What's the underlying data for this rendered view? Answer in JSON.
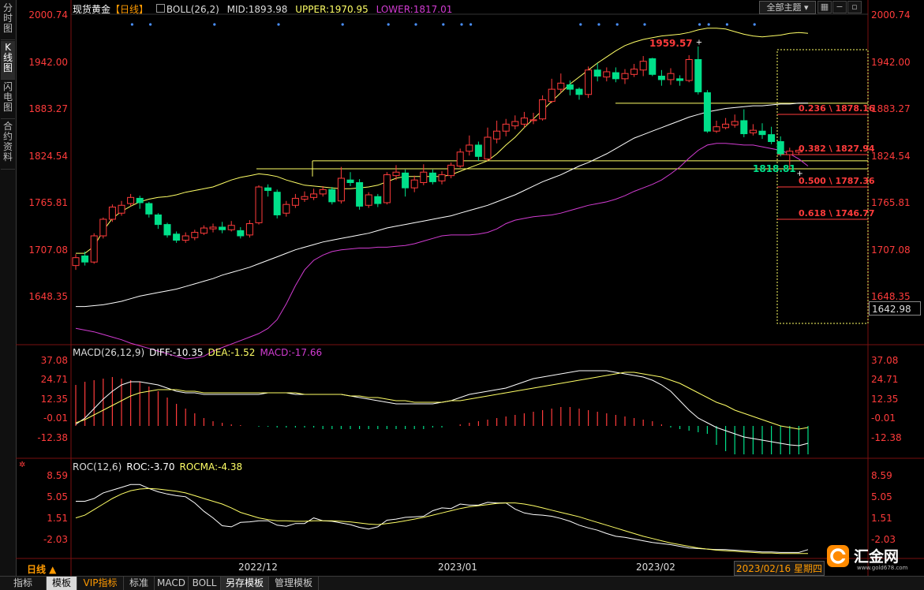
{
  "left_tabs": [
    "分时图",
    "K线图",
    "闪电图",
    "合约资料"
  ],
  "main_legend": {
    "symbol": "现货黄金",
    "period_tag": "【日线】",
    "indicator": "BOLL(26,2)",
    "mid": "MID:1893.98",
    "upper": "UPPER:1970.95",
    "lower": "LOWER:1817.01"
  },
  "theme_select": "全部主题",
  "price_axis": [
    "2000.74",
    "1942.00",
    "1883.27",
    "1824.54",
    "1765.81",
    "1707.08",
    "1648.35"
  ],
  "current_price_box": "1642.98",
  "annotations": {
    "high": "1959.57",
    "low": "1818.81"
  },
  "fib_labels": [
    "0.236 \\ 1878.16",
    "0.382 \\ 1827.94",
    "0.500 \\ 1787.36",
    "0.618 \\ 1746.77"
  ],
  "macd": {
    "legend": {
      "name": "MACD(26,12,9)",
      "diff": "DIFF:-10.35",
      "dea": "DEA:-1.52",
      "macd": "MACD:-17.66"
    },
    "axis": [
      "37.08",
      "24.71",
      "12.35",
      "-0.01",
      "-12.38"
    ]
  },
  "roc": {
    "legend": {
      "name": "ROC(12,6)",
      "roc": "ROC:-3.70",
      "rocma": "ROCMA:-4.38"
    },
    "axis": [
      "8.59",
      "5.05",
      "1.51",
      "-2.03"
    ]
  },
  "time_axis": [
    "2022/12",
    "2023/01",
    "2023/02"
  ],
  "period_label": "日线 ▲",
  "cursor_date": "2023/02/16 星期四",
  "bottom_tabs": [
    "指标",
    "模板",
    "VIP指标",
    "标准",
    "MACD",
    "BOLL",
    "另存模板",
    "管理模板"
  ],
  "active_bottom_tab": "模板",
  "logo": {
    "text": "汇金网",
    "url": "www.gold678.com"
  },
  "colors": {
    "up": "#ff3b3b",
    "down": "#00e08a",
    "boll_upper": "#ffff66",
    "boll_mid": "#ffffff",
    "boll_lower": "#d23cd2",
    "fib": "#ff3b3b",
    "accent": "#ff9a00"
  },
  "chart_data": {
    "type": "candlestick",
    "ylim": [
      1620,
      2005
    ],
    "candles": [
      {
        "o": 1708,
        "c": 1717,
        "h": 1721,
        "l": 1703
      },
      {
        "o": 1719,
        "c": 1712,
        "h": 1724,
        "l": 1708
      },
      {
        "o": 1712,
        "c": 1742,
        "h": 1745,
        "l": 1710
      },
      {
        "o": 1742,
        "c": 1761,
        "h": 1763,
        "l": 1739
      },
      {
        "o": 1761,
        "c": 1775,
        "h": 1778,
        "l": 1758
      },
      {
        "o": 1768,
        "c": 1777,
        "h": 1782,
        "l": 1765
      },
      {
        "o": 1779,
        "c": 1786,
        "h": 1790,
        "l": 1776
      },
      {
        "o": 1785,
        "c": 1780,
        "h": 1788,
        "l": 1773
      },
      {
        "o": 1779,
        "c": 1767,
        "h": 1781,
        "l": 1763
      },
      {
        "o": 1766,
        "c": 1755,
        "h": 1768,
        "l": 1750
      },
      {
        "o": 1755,
        "c": 1743,
        "h": 1757,
        "l": 1740
      },
      {
        "o": 1744,
        "c": 1737,
        "h": 1747,
        "l": 1734
      },
      {
        "o": 1737,
        "c": 1742,
        "h": 1746,
        "l": 1734
      },
      {
        "o": 1740,
        "c": 1746,
        "h": 1749,
        "l": 1737
      },
      {
        "o": 1745,
        "c": 1751,
        "h": 1754,
        "l": 1743
      },
      {
        "o": 1750,
        "c": 1752,
        "h": 1756,
        "l": 1746
      },
      {
        "o": 1752,
        "c": 1749,
        "h": 1758,
        "l": 1745
      },
      {
        "o": 1749,
        "c": 1754,
        "h": 1759,
        "l": 1747
      },
      {
        "o": 1748,
        "c": 1742,
        "h": 1752,
        "l": 1739
      },
      {
        "o": 1743,
        "c": 1756,
        "h": 1760,
        "l": 1740
      },
      {
        "o": 1757,
        "c": 1798,
        "h": 1800,
        "l": 1755
      },
      {
        "o": 1797,
        "c": 1794,
        "h": 1801,
        "l": 1787
      },
      {
        "o": 1792,
        "c": 1766,
        "h": 1795,
        "l": 1762
      },
      {
        "o": 1768,
        "c": 1778,
        "h": 1782,
        "l": 1764
      },
      {
        "o": 1777,
        "c": 1785,
        "h": 1790,
        "l": 1774
      },
      {
        "o": 1784,
        "c": 1787,
        "h": 1793,
        "l": 1781
      },
      {
        "o": 1786,
        "c": 1790,
        "h": 1796,
        "l": 1783
      },
      {
        "o": 1790,
        "c": 1795,
        "h": 1799,
        "l": 1787
      },
      {
        "o": 1795,
        "c": 1781,
        "h": 1798,
        "l": 1778
      },
      {
        "o": 1782,
        "c": 1808,
        "h": 1821,
        "l": 1779
      },
      {
        "o": 1806,
        "c": 1803,
        "h": 1815,
        "l": 1799
      },
      {
        "o": 1803,
        "c": 1776,
        "h": 1807,
        "l": 1772
      },
      {
        "o": 1777,
        "c": 1789,
        "h": 1792,
        "l": 1774
      },
      {
        "o": 1787,
        "c": 1779,
        "h": 1790,
        "l": 1775
      },
      {
        "o": 1780,
        "c": 1812,
        "h": 1815,
        "l": 1778
      },
      {
        "o": 1811,
        "c": 1815,
        "h": 1823,
        "l": 1806
      },
      {
        "o": 1814,
        "c": 1797,
        "h": 1818,
        "l": 1787
      },
      {
        "o": 1797,
        "c": 1806,
        "h": 1811,
        "l": 1792
      },
      {
        "o": 1803,
        "c": 1815,
        "h": 1824,
        "l": 1800
      },
      {
        "o": 1814,
        "c": 1804,
        "h": 1818,
        "l": 1801
      },
      {
        "o": 1805,
        "c": 1812,
        "h": 1816,
        "l": 1801
      },
      {
        "o": 1811,
        "c": 1823,
        "h": 1826,
        "l": 1808
      },
      {
        "o": 1822,
        "c": 1838,
        "h": 1842,
        "l": 1820
      },
      {
        "o": 1839,
        "c": 1846,
        "h": 1857,
        "l": 1834
      },
      {
        "o": 1846,
        "c": 1833,
        "h": 1850,
        "l": 1828
      },
      {
        "o": 1830,
        "c": 1855,
        "h": 1866,
        "l": 1828
      },
      {
        "o": 1853,
        "c": 1862,
        "h": 1874,
        "l": 1848
      },
      {
        "o": 1862,
        "c": 1870,
        "h": 1876,
        "l": 1856
      },
      {
        "o": 1868,
        "c": 1873,
        "h": 1880,
        "l": 1864
      },
      {
        "o": 1870,
        "c": 1877,
        "h": 1884,
        "l": 1866
      },
      {
        "o": 1874,
        "c": 1875,
        "h": 1883,
        "l": 1870
      },
      {
        "o": 1876,
        "c": 1898,
        "h": 1903,
        "l": 1874
      },
      {
        "o": 1896,
        "c": 1910,
        "h": 1922,
        "l": 1894
      },
      {
        "o": 1910,
        "c": 1917,
        "h": 1928,
        "l": 1906
      },
      {
        "o": 1915,
        "c": 1910,
        "h": 1920,
        "l": 1903
      },
      {
        "o": 1910,
        "c": 1904,
        "h": 1912,
        "l": 1898
      },
      {
        "o": 1904,
        "c": 1932,
        "h": 1936,
        "l": 1900
      },
      {
        "o": 1932,
        "c": 1925,
        "h": 1940,
        "l": 1919
      },
      {
        "o": 1924,
        "c": 1930,
        "h": 1935,
        "l": 1919
      },
      {
        "o": 1929,
        "c": 1922,
        "h": 1935,
        "l": 1918
      },
      {
        "o": 1922,
        "c": 1928,
        "h": 1933,
        "l": 1916
      },
      {
        "o": 1927,
        "c": 1933,
        "h": 1939,
        "l": 1924
      },
      {
        "o": 1932,
        "c": 1942,
        "h": 1948,
        "l": 1925
      },
      {
        "o": 1945,
        "c": 1927,
        "h": 1946,
        "l": 1925
      },
      {
        "o": 1925,
        "c": 1921,
        "h": 1932,
        "l": 1914
      },
      {
        "o": 1921,
        "c": 1928,
        "h": 1934,
        "l": 1915
      },
      {
        "o": 1922,
        "c": 1920,
        "h": 1926,
        "l": 1914
      },
      {
        "o": 1920,
        "c": 1944,
        "h": 1949,
        "l": 1918
      },
      {
        "o": 1944,
        "c": 1907,
        "h": 1959,
        "l": 1904
      },
      {
        "o": 1906,
        "c": 1862,
        "h": 1909,
        "l": 1860
      },
      {
        "o": 1862,
        "c": 1867,
        "h": 1874,
        "l": 1860
      },
      {
        "o": 1866,
        "c": 1870,
        "h": 1877,
        "l": 1864
      },
      {
        "o": 1869,
        "c": 1873,
        "h": 1881,
        "l": 1866
      },
      {
        "o": 1874,
        "c": 1859,
        "h": 1887,
        "l": 1855
      },
      {
        "o": 1860,
        "c": 1863,
        "h": 1870,
        "l": 1857
      },
      {
        "o": 1862,
        "c": 1858,
        "h": 1871,
        "l": 1853
      },
      {
        "o": 1858,
        "c": 1850,
        "h": 1867,
        "l": 1847
      },
      {
        "o": 1850,
        "c": 1836,
        "h": 1856,
        "l": 1833
      },
      {
        "o": 1835,
        "c": 1839,
        "h": 1843,
        "l": 1819
      },
      {
        "o": 1838,
        "c": 1840,
        "h": 1841,
        "l": 1835
      }
    ],
    "boll_upper": [
      1722,
      1722,
      1730,
      1748,
      1762,
      1770,
      1776,
      1781,
      1784,
      1786,
      1787,
      1789,
      1792,
      1794,
      1796,
      1798,
      1802,
      1806,
      1809,
      1811,
      1813,
      1812,
      1810,
      1806,
      1803,
      1800,
      1799,
      1798,
      1797,
      1796,
      1796,
      1797,
      1798,
      1800,
      1804,
      1808,
      1810,
      1810,
      1810,
      1810,
      1810,
      1812,
      1816,
      1820,
      1824,
      1828,
      1836,
      1846,
      1855,
      1866,
      1876,
      1886,
      1896,
      1906,
      1916,
      1924,
      1932,
      1940,
      1947,
      1954,
      1960,
      1964,
      1967,
      1969,
      1971,
      1972,
      1973,
      1975,
      1978,
      1980,
      1980,
      1979,
      1976,
      1973,
      1971,
      1970,
      1971,
      1972,
      1974,
      1975,
      1974
    ],
    "boll_mid": [
      1661,
      1661,
      1662,
      1663,
      1665,
      1667,
      1670,
      1673,
      1675,
      1677,
      1679,
      1681,
      1684,
      1687,
      1690,
      1693,
      1697,
      1700,
      1703,
      1706,
      1710,
      1714,
      1718,
      1722,
      1726,
      1729,
      1732,
      1735,
      1737,
      1739,
      1741,
      1743,
      1745,
      1748,
      1751,
      1753,
      1755,
      1757,
      1759,
      1761,
      1763,
      1765,
      1768,
      1771,
      1774,
      1777,
      1781,
      1785,
      1789,
      1794,
      1799,
      1804,
      1808,
      1812,
      1817,
      1822,
      1826,
      1831,
      1836,
      1842,
      1848,
      1854,
      1858,
      1862,
      1866,
      1870,
      1874,
      1878,
      1881,
      1884,
      1886,
      1888,
      1889,
      1890,
      1891,
      1891,
      1892,
      1893,
      1893,
      1894,
      1894
    ],
    "boll_lower": [
      1636,
      1634,
      1632,
      1629,
      1626,
      1623,
      1619,
      1616,
      1613,
      1610,
      1607,
      1604,
      1601,
      1602,
      1604,
      1610,
      1614,
      1618,
      1622,
      1626,
      1630,
      1636,
      1646,
      1664,
      1685,
      1703,
      1714,
      1720,
      1724,
      1726,
      1727,
      1728,
      1728,
      1729,
      1729,
      1730,
      1731,
      1733,
      1736,
      1739,
      1742,
      1743,
      1743,
      1743,
      1744,
      1746,
      1750,
      1756,
      1760,
      1762,
      1764,
      1765,
      1766,
      1768,
      1771,
      1774,
      1777,
      1779,
      1781,
      1784,
      1788,
      1793,
      1797,
      1801,
      1806,
      1813,
      1821,
      1831,
      1840,
      1846,
      1848,
      1848,
      1847,
      1846,
      1846,
      1844,
      1842,
      1840,
      1836,
      1830,
      1822
    ],
    "macd_hist": [
      26,
      28,
      29,
      30,
      31,
      30,
      29,
      28,
      25,
      22,
      18,
      14,
      11,
      8,
      5,
      3,
      2,
      1,
      0.5,
      0,
      -0.5,
      -0.5,
      -1,
      -1,
      -1,
      -1,
      -1,
      -2,
      -2,
      -2,
      -2,
      -2,
      -2,
      -2,
      -2,
      -2,
      -2,
      -2,
      -2,
      -1,
      -1,
      0,
      1,
      2,
      3,
      4,
      5,
      6,
      7,
      8,
      9,
      10,
      11,
      12,
      12,
      11,
      10,
      9,
      8,
      7,
      6,
      5,
      4,
      3,
      1,
      -1,
      -2,
      -3,
      -4,
      -5,
      -12,
      -16,
      -18,
      -18,
      -18,
      -18,
      -18,
      -18,
      -18,
      -18,
      -18
    ],
    "macd_diff": [
      1,
      5,
      11,
      17,
      22,
      26,
      28,
      28,
      27,
      26,
      24,
      22,
      21,
      21,
      20,
      20,
      20,
      20,
      20,
      20,
      20,
      21,
      21,
      21,
      20,
      20,
      20,
      20,
      20,
      20,
      19,
      18,
      17,
      16,
      15,
      14,
      14,
      14,
      14,
      14,
      15,
      16,
      18,
      20,
      21,
      22,
      23,
      24,
      26,
      28,
      30,
      31,
      32,
      33,
      34,
      35,
      35,
      35,
      35,
      34,
      33,
      32,
      31,
      29,
      26,
      22,
      16,
      10,
      5,
      2,
      -1,
      -3,
      -5,
      -7,
      -8,
      -9,
      -10,
      -11,
      -12,
      -12.5,
      -11
    ],
    "macd_dea": [
      2,
      4,
      7,
      10,
      13,
      16,
      19,
      21,
      22,
      23,
      23,
      23,
      22,
      22,
      21,
      21,
      21,
      21,
      21,
      21,
      21,
      21,
      21,
      21,
      21,
      20,
      20,
      20,
      20,
      20,
      19,
      19,
      18,
      18,
      17,
      16,
      16,
      15,
      15,
      15,
      15,
      16,
      16,
      17,
      18,
      19,
      20,
      21,
      22,
      23,
      24,
      25,
      26,
      27,
      28,
      29,
      30,
      31,
      32,
      33,
      34,
      34,
      33,
      32,
      31,
      29,
      27,
      24,
      21,
      18,
      15,
      13,
      10,
      8,
      6,
      4,
      2,
      0,
      -1,
      -2,
      -1
    ],
    "roc": [
      5,
      5,
      5.5,
      6.5,
      7,
      7.5,
      8,
      8,
      7.3,
      6.7,
      6.3,
      6,
      5.8,
      4.7,
      3.2,
      2,
      0.6,
      0.4,
      1.2,
      1.3,
      1.5,
      1.5,
      0.7,
      0.5,
      1,
      1,
      2,
      1.5,
      1.4,
      1.1,
      0.8,
      0.3,
      0,
      0.4,
      1.6,
      1.8,
      2.1,
      2.2,
      2.3,
      3.3,
      3.8,
      3.7,
      4.5,
      4.3,
      4.3,
      4.8,
      4.7,
      4.7,
      3.6,
      2.9,
      2.6,
      2.5,
      2.3,
      1.9,
      1.4,
      0.7,
      0.2,
      -0.2,
      -0.8,
      -1.3,
      -1.5,
      -1.8,
      -2.1,
      -2.4,
      -2.6,
      -2.8,
      -3.1,
      -3.4,
      -3.5,
      -3.6,
      -3.7,
      -3.7,
      -3.8,
      -3.9,
      -4,
      -4.1,
      -4.1,
      -4.2,
      -4.2,
      -4.2,
      -3.7
    ],
    "rocma": [
      2,
      2.5,
      3.5,
      4.5,
      5.5,
      6.3,
      6.9,
      7.2,
      7.3,
      7.2,
      7,
      6.8,
      6.5,
      6,
      5.5,
      5,
      4.5,
      3.8,
      3,
      2.5,
      2,
      1.7,
      1.5,
      1.5,
      1.4,
      1.4,
      1.5,
      1.5,
      1.5,
      1.4,
      1.3,
      1.1,
      0.9,
      0.8,
      1,
      1.2,
      1.5,
      1.8,
      2.1,
      2.5,
      2.9,
      3.3,
      3.7,
      4,
      4.2,
      4.4,
      4.6,
      4.7,
      4.7,
      4.5,
      4.2,
      3.8,
      3.4,
      3,
      2.6,
      2.2,
      1.7,
      1.2,
      0.7,
      0.2,
      -0.3,
      -0.8,
      -1.3,
      -1.7,
      -2.1,
      -2.5,
      -2.8,
      -3.1,
      -3.4,
      -3.6,
      -3.8,
      -3.9,
      -4,
      -4.1,
      -4.2,
      -4.3,
      -4.3,
      -4.4,
      -4.4,
      -4.4,
      -4.4
    ],
    "macd_ylim": [
      -20,
      44
    ],
    "roc_ylim": [
      -5,
      10.6
    ]
  }
}
